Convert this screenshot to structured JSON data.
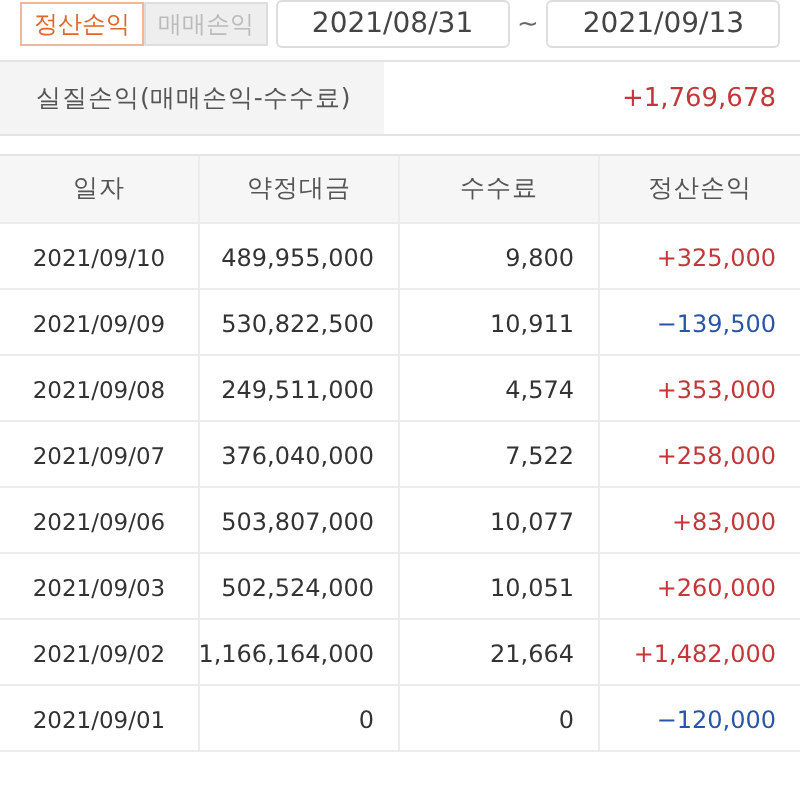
{
  "mode_tabs": [
    {
      "label": "정산손익",
      "selected": true
    },
    {
      "label": "매매손익",
      "selected": false
    }
  ],
  "date_range": {
    "start": "2021/08/31",
    "separator": "~",
    "end": "2021/09/13"
  },
  "summary": {
    "label": "실질손익(매매손익-수수료)",
    "value": "+1,769,678",
    "color": "#c3373a"
  },
  "table": {
    "columns": [
      "일자",
      "약정대금",
      "수수료",
      "정산손익"
    ],
    "rows": [
      {
        "date": "2021/09/10",
        "amount": "489,955,000",
        "fee": "9,800",
        "profit": "+325,000",
        "color": "#c3373a"
      },
      {
        "date": "2021/09/09",
        "amount": "530,822,500",
        "fee": "10,911",
        "profit": "−139,500",
        "color": "#2a55a5"
      },
      {
        "date": "2021/09/08",
        "amount": "249,511,000",
        "fee": "4,574",
        "profit": "+353,000",
        "color": "#c3373a"
      },
      {
        "date": "2021/09/07",
        "amount": "376,040,000",
        "fee": "7,522",
        "profit": "+258,000",
        "color": "#c3373a"
      },
      {
        "date": "2021/09/06",
        "amount": "503,807,000",
        "fee": "10,077",
        "profit": "+83,000",
        "color": "#c3373a"
      },
      {
        "date": "2021/09/03",
        "amount": "502,524,000",
        "fee": "10,051",
        "profit": "+260,000",
        "color": "#c3373a"
      },
      {
        "date": "2021/09/02",
        "amount": "1,166,164,000",
        "fee": "21,664",
        "profit": "+1,482,000",
        "color": "#c3373a"
      },
      {
        "date": "2021/09/01",
        "amount": "0",
        "fee": "0",
        "profit": "−120,000",
        "color": "#2a55a5"
      }
    ]
  }
}
